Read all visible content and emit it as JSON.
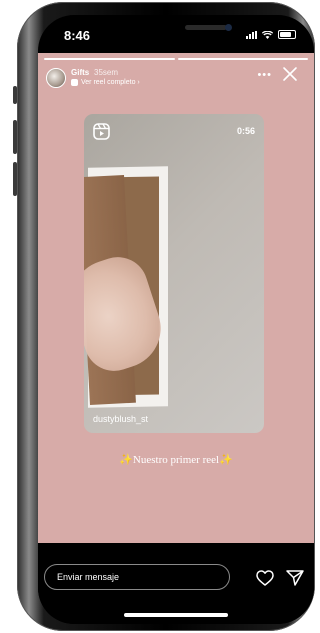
{
  "status_bar": {
    "time": "8:46",
    "icons": [
      "cellular-signal-icon",
      "wifi-icon",
      "battery-icon"
    ]
  },
  "story": {
    "background_color": "#d7aba8",
    "progress_segments": 2,
    "active_segment": 1,
    "user_name": "Gifts",
    "post_time": "35sem",
    "reel_link_text": "Ver reel completo ›",
    "more_icon": "more-horizontal-icon",
    "close_icon": "close-icon",
    "reel": {
      "duration": "0:56",
      "user": "dustyblush_st",
      "icon": "reels-icon"
    },
    "caption": {
      "spark_left": "✨",
      "text": "Nuestro primer reel",
      "spark_right": "✨"
    }
  },
  "bottom_bar": {
    "message_placeholder": "Enviar mensaje",
    "heart_icon": "heart-icon",
    "send_icon": "send-icon"
  }
}
